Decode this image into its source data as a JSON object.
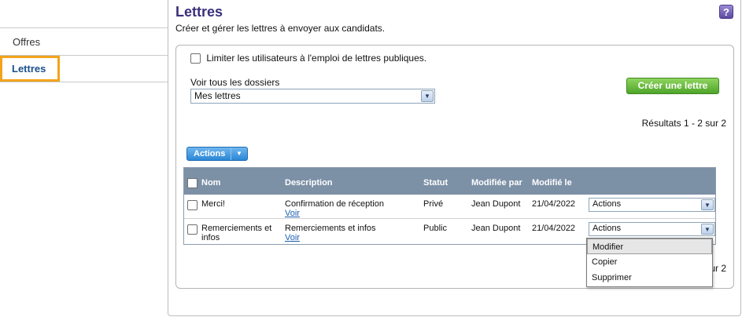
{
  "nav": {
    "items": [
      {
        "label": "Offres"
      },
      {
        "label": "Lettres"
      }
    ]
  },
  "header": {
    "title": "Lettres",
    "help_label": "?",
    "subtitle": "Créer et gérer les lettres à envoyer aux candidats."
  },
  "filters": {
    "limit_label": "Limiter les utilisateurs à l'emploi de lettres publiques.",
    "folder_label": "Voir tous les dossiers",
    "folder_value": "Mes lettres"
  },
  "create_button": "Créer une lettre",
  "results_top": "Résultats 1 - 2 sur 2",
  "results_bottom": "ur 2",
  "actions_button": "Actions",
  "table": {
    "headers": [
      "Nom",
      "Description",
      "Statut",
      "Modifiée par",
      "Modifié le"
    ],
    "rows": [
      {
        "name": "Merci!",
        "description": "Confirmation de réception",
        "view": "Voir",
        "status": "Privé",
        "modified_by": "Jean Dupont",
        "modified_on": "21/04/2022",
        "action": "Actions"
      },
      {
        "name_line1": "Remerciements et",
        "name_line2": "infos",
        "description": "Remerciements et infos",
        "view": "Voir",
        "status": "Public",
        "modified_by": "Jean Dupont",
        "modified_on": "21/04/2022",
        "action": "Actions"
      }
    ]
  },
  "dropdown": {
    "options": [
      "Modifier",
      "Copier",
      "Supprimer"
    ]
  },
  "colors": {
    "accent": "#f2a31b",
    "title": "#3a2f7a",
    "header_bg": "#7c90a6",
    "create_green": "#4fa52a",
    "actions_blue": "#2b87d6"
  }
}
